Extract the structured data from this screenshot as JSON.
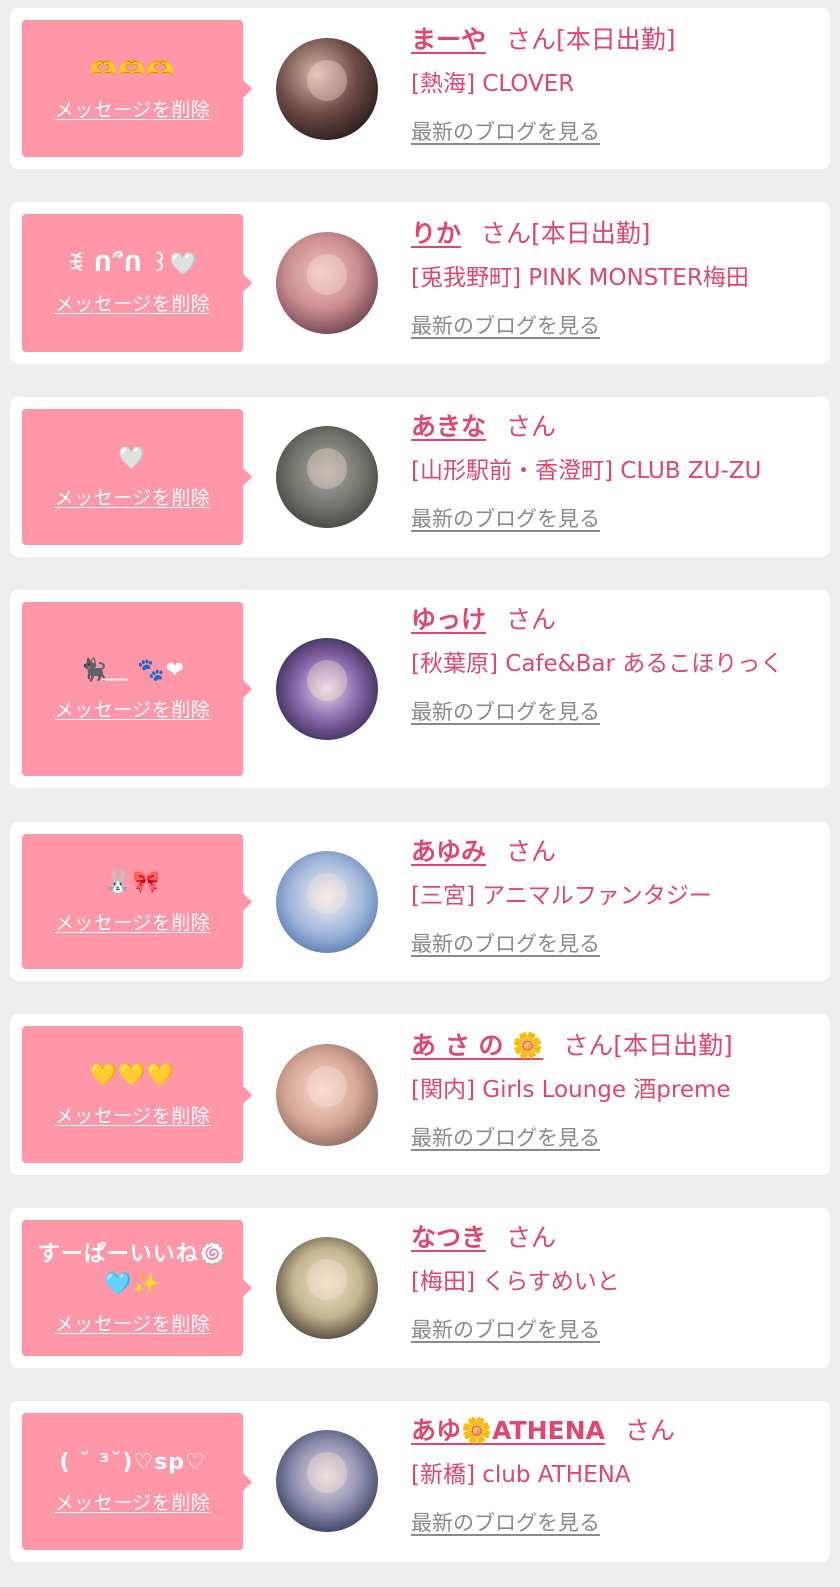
{
  "colors": {
    "page_bg": "#eeeeee",
    "card_bg": "#ffffff",
    "bubble_bg": "#ff97a8",
    "accent": "#e0466e",
    "link_gray": "#8a8a8a"
  },
  "delete_label": "メッセージを削除",
  "blog_label": "最新のブログを見る",
  "honorific": "さん",
  "entries": [
    {
      "message": "🫶🫶🫶",
      "name": "まーや",
      "attendance": "[本日出勤]",
      "shop": "[熱海] CLOVER"
    },
    {
      "message": "ꉂ ᑎ՞ᑎ ꒱🤍",
      "name": "りか",
      "attendance": "[本日出勤]",
      "shop": "[兎我野町] PINK MONSTER梅田"
    },
    {
      "message": "🤍",
      "name": "あきな",
      "attendance": "",
      "shop": "[山形駅前・香澄町] CLUB ZU-ZU"
    },
    {
      "message": "🐈‍⬛𝅽 𝅽 𝅽 𝅽 🐾❤",
      "name": "ゆっけ",
      "attendance": "",
      "shop": "[秋葉原] Cafe&Bar あるこほりっく"
    },
    {
      "message": "🐰🎀",
      "name": "あゆみ",
      "attendance": "",
      "shop": "[三宮] アニマルファンタジー"
    },
    {
      "message": "💛💛💛",
      "name": "あ さ の 🌼",
      "attendance": "[本日出勤]",
      "shop": "[関内] Girls Lounge 酒preme"
    },
    {
      "message": "すーぱーいいね🍥\n🩵✨",
      "name": "なつき",
      "attendance": "",
      "shop": "[梅田] くらすめいと"
    },
    {
      "message": "( ˘ ³˘)♡sp♡",
      "name": "あゆ🌼ATHENA",
      "attendance": "",
      "shop": "[新橋] club ATHENA"
    }
  ]
}
